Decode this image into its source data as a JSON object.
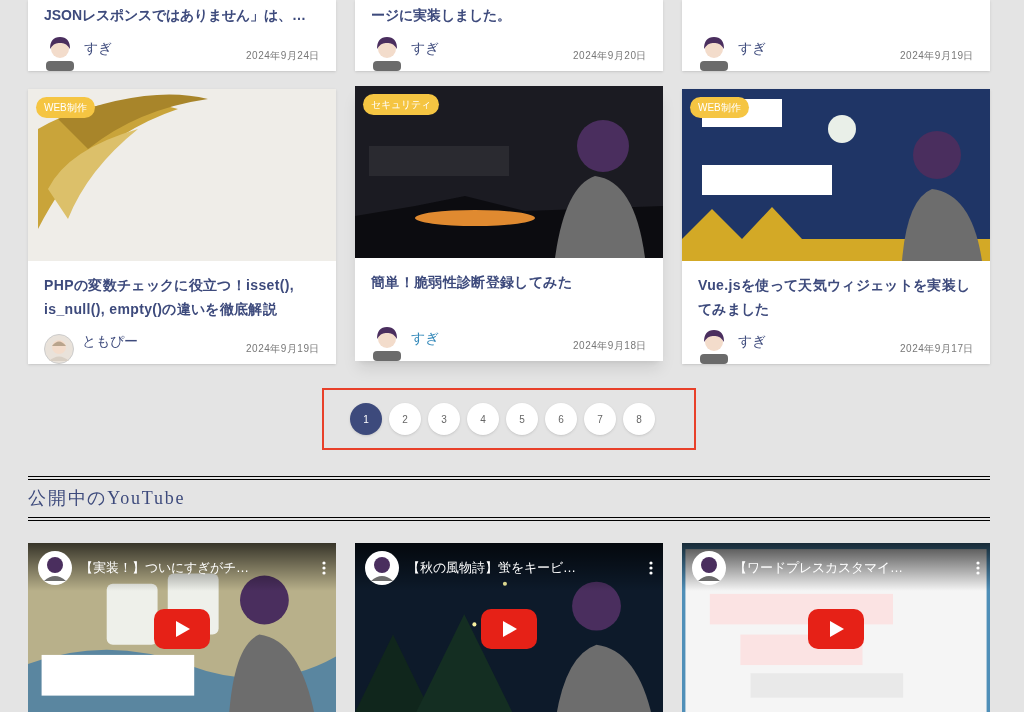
{
  "top_posts": [
    {
      "title": "JSONレスポンスではありません」は、…",
      "author": "すぎ",
      "avatar": {
        "kind": "character"
      },
      "date": "2024年9月24日"
    },
    {
      "title": "ージに実装しました。",
      "author": "すぎ",
      "avatar": {
        "kind": "character"
      },
      "date": "2024年9月20日"
    },
    {
      "author": "すぎ",
      "avatar": {
        "kind": "character"
      },
      "date": "2024年9月19日"
    }
  ],
  "posts": [
    {
      "category": "WEB制作",
      "title": "PHPの変数チェックに役立つ！isset(), is_null(), empty()の違いを徹底解説",
      "author": "ともぴー",
      "avatar": {
        "kind": "figure"
      },
      "date": "2024年9月19日",
      "hovered": false
    },
    {
      "category": "セキュリティ",
      "title": "簡単！脆弱性診断登録してみた",
      "author": "すぎ",
      "avatar": {
        "kind": "character"
      },
      "date": "2024年9月18日",
      "hovered": true
    },
    {
      "category": "WEB制作",
      "title": "Vue.jsを使って天気ウィジェットを実装してみました",
      "author": "すぎ",
      "avatar": {
        "kind": "character"
      },
      "date": "2024年9月17日",
      "hovered": false
    }
  ],
  "pagination": [
    {
      "label": "1",
      "selected": true
    },
    {
      "label": "2",
      "selected": false
    },
    {
      "label": "3",
      "selected": false
    },
    {
      "label": "4",
      "selected": false
    },
    {
      "label": "5",
      "selected": false
    },
    {
      "label": "6",
      "selected": false
    },
    {
      "label": "7",
      "selected": false
    },
    {
      "label": "8",
      "selected": false
    }
  ],
  "section_title": "公開中のYouTube",
  "videos": [
    {
      "title": "【実装！】ついにすぎがチ…"
    },
    {
      "title": "【秋の風物詩】蛍をキービ…"
    },
    {
      "title": "【ワードプレスカスタマイ…"
    }
  ]
}
